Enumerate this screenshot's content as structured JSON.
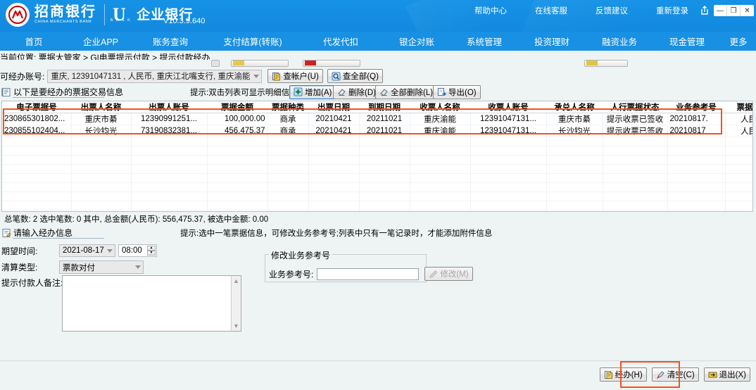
{
  "header": {
    "bank_cn": "招商银行",
    "bank_en": "CHINA MERCHANTS BANK",
    "product_u": "U",
    "product_bank": "B A N K",
    "product_cn": "企业银行",
    "version": "V10.3.9.640",
    "links": [
      "帮助中心",
      "在线客服",
      "反馈建议",
      "重新登录"
    ],
    "window": {
      "minimize": "—",
      "maximize": "❐",
      "close": "✕"
    }
  },
  "nav": {
    "items": [
      {
        "label": "首页",
        "active": true
      },
      {
        "label": "企业APP",
        "active": false
      },
      {
        "label": "账务查询",
        "active": false
      },
      {
        "label": "支付结算(转账)",
        "active": false
      },
      {
        "label": "代发代扣",
        "active": false
      },
      {
        "label": "银企对账",
        "active": false
      },
      {
        "label": "系统管理",
        "active": false
      },
      {
        "label": "投资理财",
        "active": false
      },
      {
        "label": "融资业务",
        "active": false
      },
      {
        "label": "现金管理",
        "active": false
      },
      {
        "label": "更多",
        "active": false
      }
    ]
  },
  "breadcrumb": {
    "prefix": "当前位置:",
    "text": "当前位置: 票据大管家 > G|电票提示付款 > 提示付款经办"
  },
  "account": {
    "label": "可经办账号:",
    "value": "重庆, 12391047131        , 人民币, 重庆江北嘴支行, 重庆渝能",
    "btn_check_account": "查帐户(U)",
    "btn_check_all": "查全部(Q)"
  },
  "section": {
    "title": "以下是要经办的票据交易信息",
    "hint": "提示:双击列表可显示明细信息",
    "btn_add": "增加(A)",
    "btn_delete": "删除(D)",
    "btn_delete_all": "全部删除(L)",
    "btn_export": "导出(O)"
  },
  "table": {
    "columns": [
      "电子票据号",
      "出票人名称",
      "出票人账号",
      "票据金额",
      "票据种类",
      "出票日期",
      "到期日期",
      "收票人名称",
      "收票人账号",
      "承兑人名称",
      "人行票据状态",
      "业务参考号",
      "票据货币"
    ],
    "rows": [
      {
        "bill_no": "230865301802...",
        "drawer_name": "重庆市綦",
        "drawer_acct": "12390991251...",
        "amount": "100,000.00",
        "bill_type": "商承",
        "issue_date": "20210421",
        "due_date": "20211021",
        "payee_name": "重庆渝能",
        "payee_acct": "12391047131...",
        "acceptor_name": "重庆市綦",
        "pboc_status": "提示收票已签收",
        "biz_ref_no": "20210817.",
        "currency": "人民币"
      },
      {
        "bill_no": "230855102404...",
        "drawer_name": "长沙钧光",
        "drawer_acct": "73190832381...",
        "amount": "456,475.37",
        "bill_type": "商承",
        "issue_date": "20210421",
        "due_date": "20211021",
        "payee_name": "重庆渝能",
        "payee_acct": "12391047131...",
        "acceptor_name": "长沙钧光",
        "pboc_status": "提示收票已签收",
        "biz_ref_no": "20210817",
        "currency": "人民币"
      }
    ]
  },
  "summary": {
    "text": "总笔数: 2   选中笔数: 0   其中, 总金额(人民币): 556,475.37, 被选中金额: 0.00"
  },
  "operator_section": {
    "title": "请输入经办信息",
    "hint": "提示:选中一笔票据信息，可修改业务参考号;列表中只有一笔记录时，才能添加附件信息"
  },
  "form": {
    "expect_time_label": "期望时间:",
    "expect_date_value": "2021-08-17",
    "expect_clock_value": "08:00",
    "settle_type_label": "清算类型:",
    "settle_type_value": "票款对付",
    "remark_label": "提示付款人备注:",
    "remark_value": "",
    "modify_group_title": "修改业务参考号",
    "biz_ref_label": "业务参考号:",
    "biz_ref_value": "",
    "biz_ref_placeholder": "",
    "btn_modify": "修改(M)"
  },
  "footer": {
    "btn_submit": "经办(H)",
    "btn_clear": "清空(C)",
    "btn_exit": "退出(X)"
  },
  "colors": {
    "brand_blue": "#1890e3",
    "annotation_red": "#f4511e",
    "panel_bg": "#eef3f3"
  }
}
